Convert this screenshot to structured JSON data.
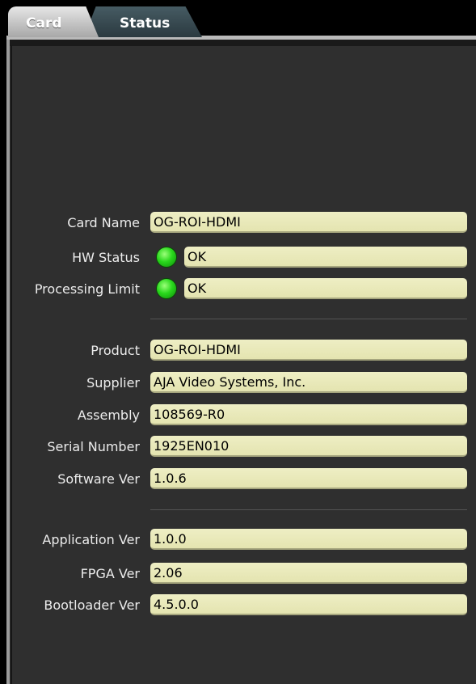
{
  "tabs": [
    {
      "label": "Card",
      "active": true
    },
    {
      "label": "Status",
      "active": false
    }
  ],
  "card_info": {
    "card_name": {
      "label": "Card Name",
      "value": "OG-ROI-HDMI"
    },
    "hw_status": {
      "label": "HW Status",
      "value": "OK",
      "led": "green"
    },
    "processing_limit": {
      "label": "Processing Limit",
      "value": "OK",
      "led": "green"
    }
  },
  "product_info": {
    "product": {
      "label": "Product",
      "value": "OG-ROI-HDMI"
    },
    "supplier": {
      "label": "Supplier",
      "value": "AJA Video Systems, Inc."
    },
    "assembly": {
      "label": "Assembly",
      "value": "108569-R0"
    },
    "serial_number": {
      "label": "Serial Number",
      "value": "1925EN010"
    },
    "software_ver": {
      "label": "Software Ver",
      "value": "1.0.6"
    }
  },
  "version_info": {
    "application_ver": {
      "label": "Application Ver",
      "value": "1.0.0"
    },
    "fpga_ver": {
      "label": "FPGA Ver",
      "value": "2.06"
    },
    "bootloader_ver": {
      "label": "Bootloader Ver",
      "value": "4.5.0.0"
    }
  },
  "colors": {
    "field_bg": "#eeeec4",
    "panel_bg": "#2f2f2f",
    "led_ok": "#29d81c"
  }
}
